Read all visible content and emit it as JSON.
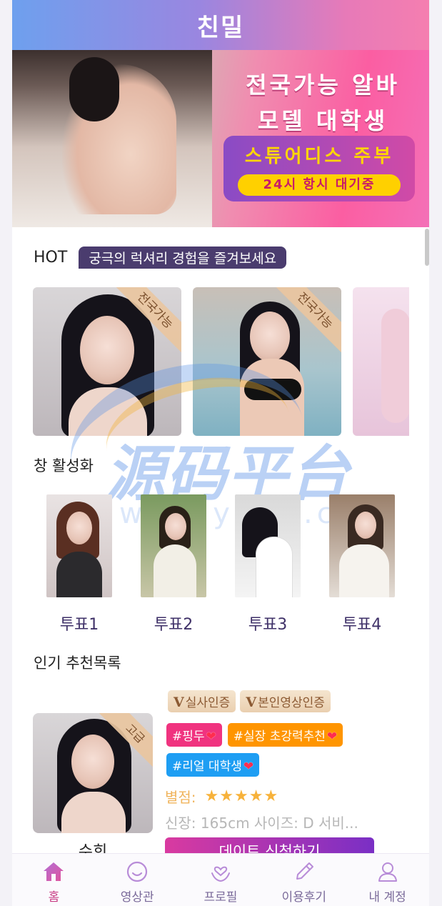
{
  "header": {
    "title": "친밀"
  },
  "banner": {
    "line1": "전국가능 알바",
    "line2": "모델 대학생",
    "sub": "스튜어디스 주부",
    "pill": "24시 항시 대기중"
  },
  "hot": {
    "label": "HOT",
    "tagline": "궁극의 럭셔리 경험을 즐겨보세요",
    "cards": [
      {
        "ribbon": "전국가능"
      },
      {
        "ribbon": "전국가능"
      },
      {
        "ribbon": ""
      }
    ]
  },
  "vote_section": {
    "title": "창 활성화",
    "items": [
      {
        "label": "투표1"
      },
      {
        "label": "투표2"
      },
      {
        "label": "투표3"
      },
      {
        "label": "투표4"
      }
    ]
  },
  "recommend": {
    "title": "인기 추천목록",
    "card": {
      "ribbon": "고급",
      "name": "수희",
      "badges": [
        {
          "mark": "V",
          "text": "실사인증"
        },
        {
          "mark": "V",
          "text": "본인영상인증"
        }
      ],
      "tags": [
        {
          "text": "#핑두",
          "color": "#f0337f"
        },
        {
          "text": "#실장 초강력추천",
          "color": "#ff9500"
        },
        {
          "text": "#리얼 대학생",
          "color": "#1e9ef3"
        }
      ],
      "rating_label": "별점:",
      "rating": 5,
      "specs": "신장: 165cm 사이즈: D 서비...",
      "cta": "데이트 신청하기"
    }
  },
  "watermark": {
    "text": "源码平台",
    "url": "www.ymot.cc"
  },
  "tabbar": {
    "items": [
      {
        "label": "홈",
        "icon": "home-icon",
        "active": true
      },
      {
        "label": "영상관",
        "icon": "smile-icon"
      },
      {
        "label": "프로필",
        "icon": "heart-hands-icon"
      },
      {
        "label": "이용후기",
        "icon": "pen-icon"
      },
      {
        "label": "내 계정",
        "icon": "user-icon"
      }
    ]
  },
  "colors": {
    "header_start": "#6ea0ee",
    "header_end": "#f57eb0",
    "hot_tag": "#4a3c6e",
    "vote_label": "#3f3168",
    "active_tab": "#c93f86",
    "inactive_tab": "#7a6a9a"
  }
}
